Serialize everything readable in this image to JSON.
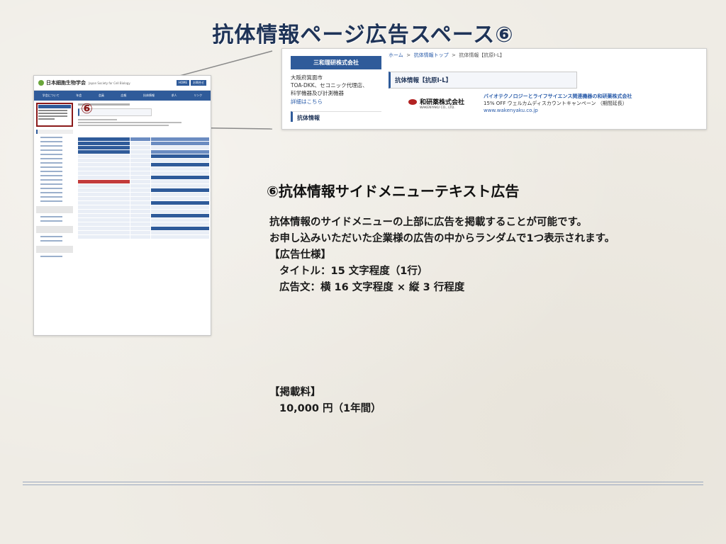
{
  "slide_title": "抗体情報ページ広告スペース⑥",
  "marker": "⑥",
  "thumbnail": {
    "logo": "日本細胞生物学会",
    "logo_sub": "Japan Society for Cell Biology",
    "header_buttons": [
      "HOME",
      "お問合せ"
    ],
    "nav": [
      "学会について",
      "年会",
      "会員",
      "広報",
      "抗体情報",
      "求人",
      "リンク"
    ]
  },
  "inset": {
    "company_header": "三和理研株式会社",
    "company_lines": [
      "大阪府箕面市",
      "TOA-DKK、セコニック代理店、",
      "科学機器及び計測機器"
    ],
    "details_link": "詳細はこちら",
    "side_section": "抗体情報",
    "breadcrumb": {
      "home": "ホーム",
      "sep": ">",
      "top": "抗体情報トップ",
      "current": "抗体情報【抗原I-L】"
    },
    "page_title": "抗体情報【抗原I-L】",
    "ad": {
      "logo_main": "和研薬株式会社",
      "logo_sub": "WAKENYAKU CO., LTD.",
      "line1": "バイオテクノロジーとライフサイエンス関連機器の和研薬株式会社",
      "line2": "15% OFF ウェルカムディスカウントキャンペーン （期間延長）",
      "line3": "www.wakenyaku.co.jp"
    }
  },
  "description": {
    "heading": "⑥抗体情報サイドメニューテキスト広告",
    "line1": "抗体情報のサイドメニューの上部に広告を掲載することが可能です。",
    "line2": "お申し込みいただいた企業様の広告の中からランダムで1つ表示されます。",
    "spec_label": "【広告仕様】",
    "spec1": "タイトル：15 文字程度（1行）",
    "spec2": "広告文：横 16 文字程度 × 縦 3 行程度"
  },
  "fee": {
    "label": "【掲載料】",
    "amount": "10,000 円（1年間）"
  }
}
